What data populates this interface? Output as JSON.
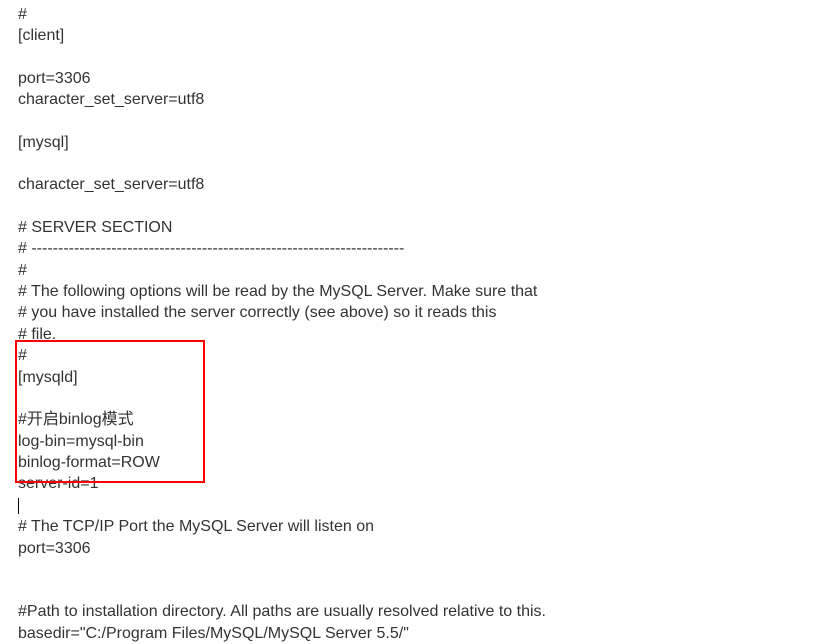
{
  "config": {
    "hash_top": "#",
    "client_section": "[client]",
    "port_line": "port=3306",
    "charset_line": "character_set_server=utf8",
    "mysql_section": "[mysql]",
    "server_section_title": "# SERVER SECTION",
    "dashes": "# ----------------------------------------------------------------------",
    "hash": "#",
    "desc1": "# The following options will be read by the MySQL Server. Make sure that",
    "desc2": "# you have installed the server correctly (see above) so it reads this",
    "desc3": "# file.",
    "mysqld_section": "[mysqld]",
    "binlog_comment": "#开启binlog模式",
    "logbin": "log-bin=mysql-bin",
    "binlog_format": "binlog-format=ROW",
    "server_id": "server-id=1",
    "tcp_comment": "# The TCP/IP Port the MySQL Server will listen on",
    "port_line2": "port=3306",
    "path_comment": "#Path to installation directory. All paths are usually resolved relative to this.",
    "basedir": "basedir=\"C:/Program Files/MySQL/MySQL Server 5.5/\""
  }
}
